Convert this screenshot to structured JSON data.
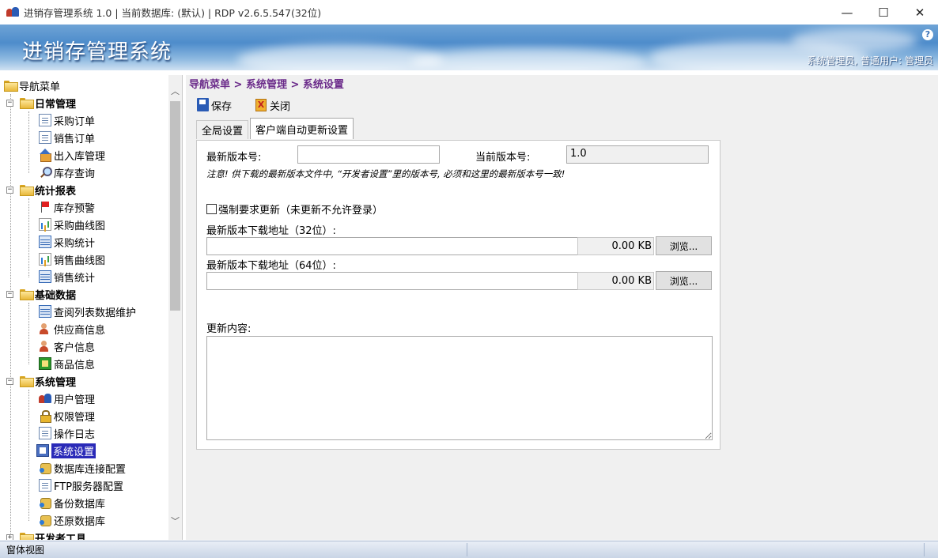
{
  "window": {
    "title": "进销存管理系统 1.0 | 当前数据库: (默认) | RDP v2.6.5.547(32位)",
    "minimize": "—",
    "maximize": "☐",
    "close": "✕"
  },
  "banner": {
    "title": "进销存管理系统",
    "help": "?",
    "user_info": "系统管理员, 普通用户: 管理员"
  },
  "tree": {
    "root": "导航菜单",
    "groups": [
      {
        "label": "日常管理",
        "items": [
          {
            "label": "采购订单",
            "icon": "document-icon"
          },
          {
            "label": "销售订单",
            "icon": "document-icon"
          },
          {
            "label": "出入库管理",
            "icon": "house-icon"
          },
          {
            "label": "库存查询",
            "icon": "search-icon"
          }
        ]
      },
      {
        "label": "统计报表",
        "items": [
          {
            "label": "库存预警",
            "icon": "flag-icon"
          },
          {
            "label": "采购曲线图",
            "icon": "chart-icon"
          },
          {
            "label": "采购统计",
            "icon": "grid-icon"
          },
          {
            "label": "销售曲线图",
            "icon": "chart-icon"
          },
          {
            "label": "销售统计",
            "icon": "grid-icon"
          }
        ]
      },
      {
        "label": "基础数据",
        "items": [
          {
            "label": "查阅列表数据维护",
            "icon": "list-icon"
          },
          {
            "label": "供应商信息",
            "icon": "person-icon"
          },
          {
            "label": "客户信息",
            "icon": "person-icon"
          },
          {
            "label": "商品信息",
            "icon": "product-icon"
          }
        ]
      },
      {
        "label": "系统管理",
        "items": [
          {
            "label": "用户管理",
            "icon": "users-icon"
          },
          {
            "label": "权限管理",
            "icon": "lock-icon"
          },
          {
            "label": "操作日志",
            "icon": "document-icon"
          },
          {
            "label": "系统设置",
            "icon": "settings-icon"
          },
          {
            "label": "数据库连接配置",
            "icon": "database-icon"
          },
          {
            "label": "FTP服务器配置",
            "icon": "document-icon"
          },
          {
            "label": "备份数据库",
            "icon": "database-icon"
          },
          {
            "label": "还原数据库",
            "icon": "database-icon"
          }
        ]
      },
      {
        "label": "开发者工具",
        "items": []
      }
    ],
    "selected": "系统设置"
  },
  "main": {
    "breadcrumb": "导航菜单 > 系统管理 > 系统设置",
    "save_label": "保存",
    "close_label": "关闭",
    "tabs": [
      "全局设置",
      "客户端自动更新设置"
    ],
    "active_tab": "客户端自动更新设置",
    "latest_version_label": "最新版本号:",
    "latest_version_value": "",
    "current_version_label": "当前版本号:",
    "current_version_value": "1.0",
    "note": "注意! 供下载的最新版本文件中, “开发者设置”里的版本号, 必须和这里的最新版本号一致!",
    "force_update_label": "强制要求更新（未更新不允许登录）",
    "force_update_checked": false,
    "url32_label": "最新版本下载地址（32位）:",
    "url32_value": "",
    "url32_size": "0.00 KB",
    "url64_label": "最新版本下载地址（64位）:",
    "url64_value": "",
    "url64_size": "0.00 KB",
    "browse_label": "浏览...",
    "changelog_label": "更新内容:",
    "changelog_value": ""
  },
  "status": {
    "text": "窗体视图"
  }
}
